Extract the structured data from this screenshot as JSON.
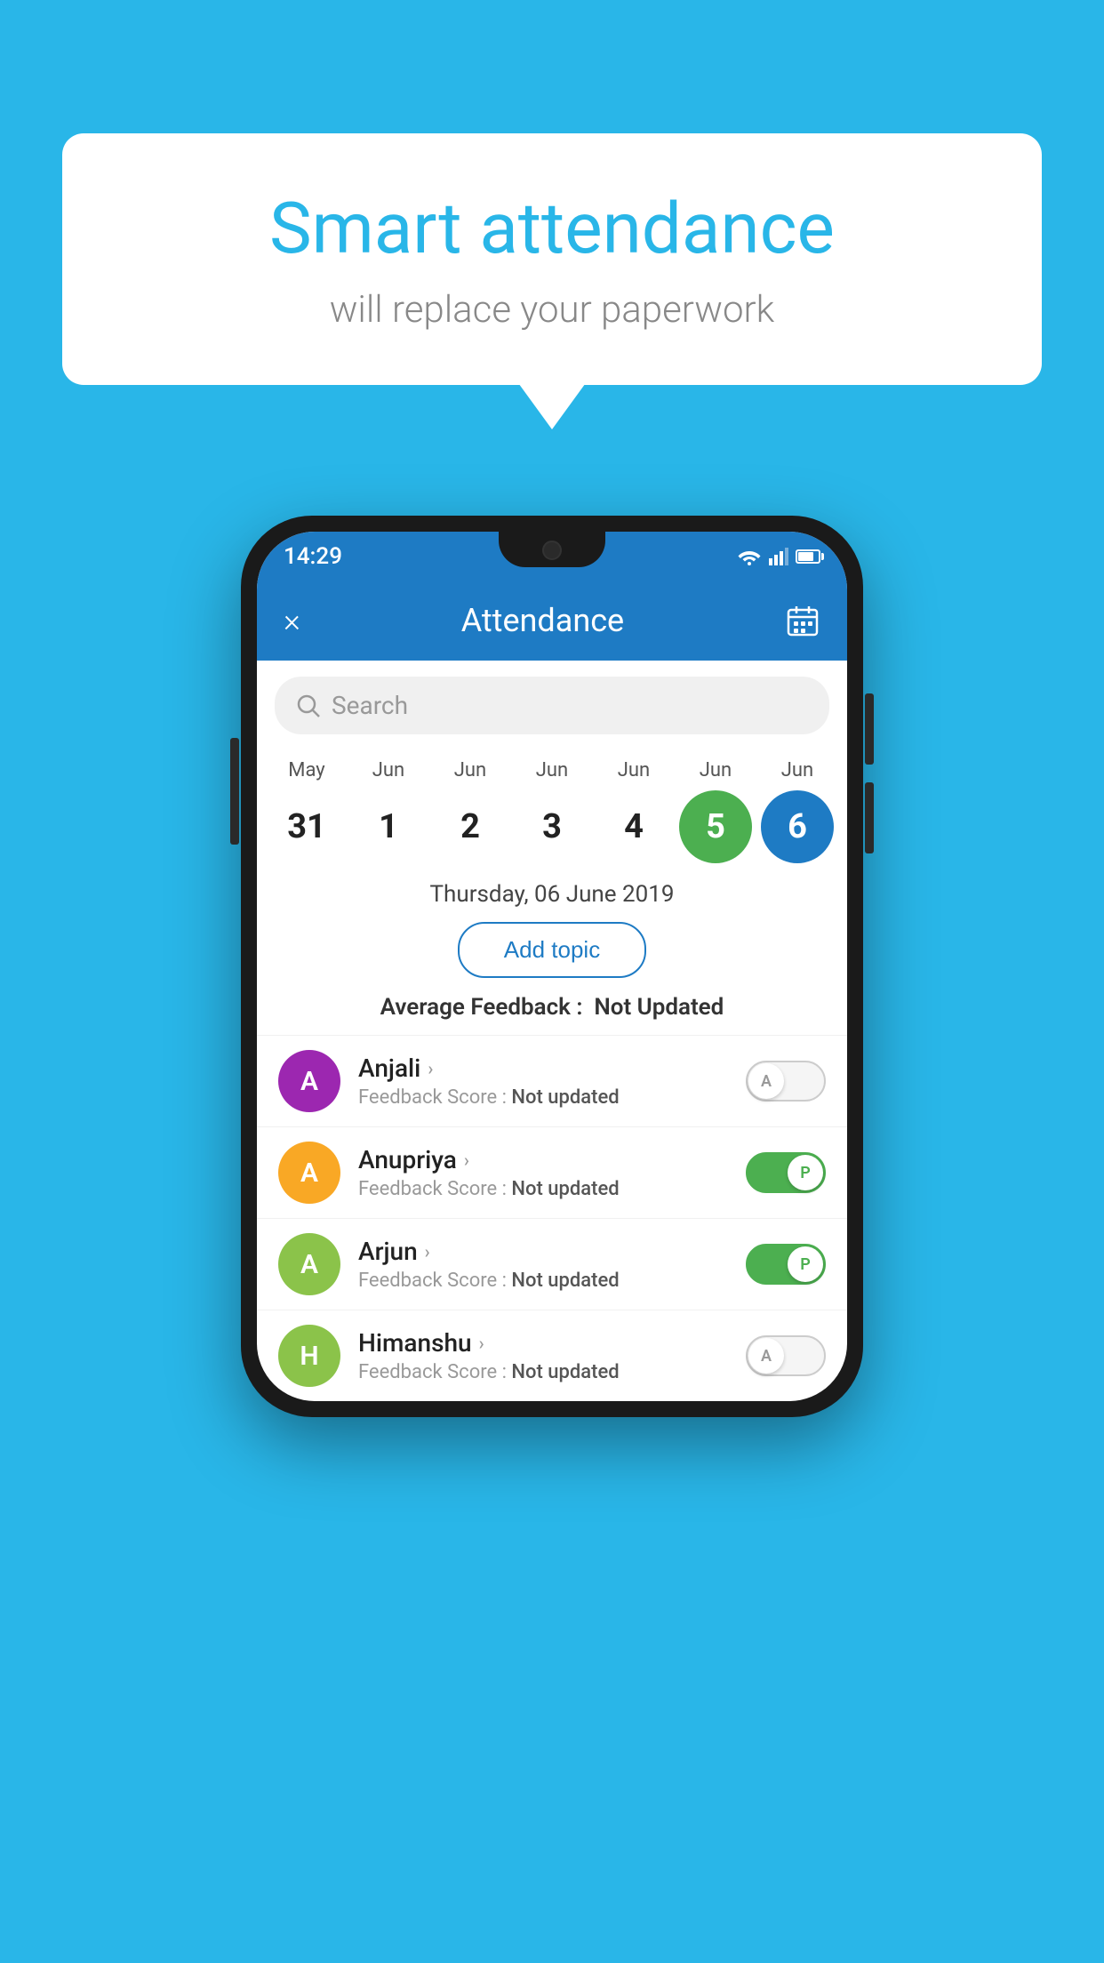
{
  "page": {
    "bg_color": "#29b6e8"
  },
  "speech_bubble": {
    "title": "Smart attendance",
    "subtitle": "will replace your paperwork"
  },
  "status_bar": {
    "time": "14:29"
  },
  "app_header": {
    "title": "Attendance",
    "close_label": "×",
    "calendar_icon": "📅"
  },
  "search": {
    "placeholder": "Search"
  },
  "calendar": {
    "months": [
      "May",
      "Jun",
      "Jun",
      "Jun",
      "Jun",
      "Jun",
      "Jun"
    ],
    "dates": [
      "31",
      "1",
      "2",
      "3",
      "4",
      "5",
      "6"
    ],
    "today_index": 5,
    "selected_index": 6
  },
  "selected_date_label": "Thursday, 06 June 2019",
  "add_topic_label": "Add topic",
  "avg_feedback_label": "Average Feedback :",
  "avg_feedback_value": "Not Updated",
  "students": [
    {
      "name": "Anjali",
      "avatar_letter": "A",
      "avatar_color": "#9c27b0",
      "feedback_label": "Feedback Score :",
      "feedback_value": "Not updated",
      "toggle_active": false,
      "toggle_label": "A"
    },
    {
      "name": "Anupriya",
      "avatar_letter": "A",
      "avatar_color": "#f9a825",
      "feedback_label": "Feedback Score :",
      "feedback_value": "Not updated",
      "toggle_active": true,
      "toggle_label": "P"
    },
    {
      "name": "Arjun",
      "avatar_letter": "A",
      "avatar_color": "#8bc34a",
      "feedback_label": "Feedback Score :",
      "feedback_value": "Not updated",
      "toggle_active": true,
      "toggle_label": "P"
    },
    {
      "name": "Himanshu",
      "avatar_letter": "H",
      "avatar_color": "#8bc34a",
      "feedback_label": "Feedback Score :",
      "feedback_value": "Not updated",
      "toggle_active": false,
      "toggle_label": "A"
    }
  ]
}
